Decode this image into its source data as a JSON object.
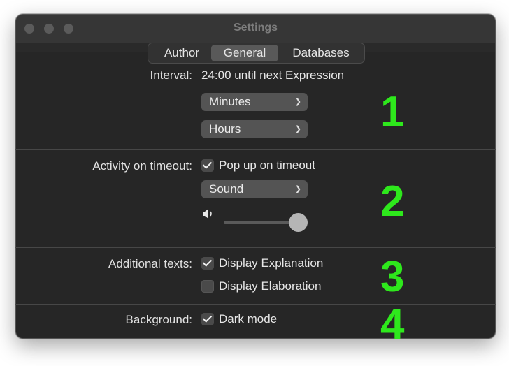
{
  "window": {
    "title": "Settings"
  },
  "tabs": [
    {
      "label": "Author",
      "selected": false
    },
    {
      "label": "General",
      "selected": true
    },
    {
      "label": "Databases",
      "selected": false
    }
  ],
  "interval": {
    "label": "Interval:",
    "value_text": "24:00 until next Expression",
    "popup_1": "Minutes",
    "popup_2": "Hours"
  },
  "activity": {
    "label": "Activity on timeout:",
    "checkbox_label": "Pop up on timeout",
    "checked": true,
    "sound_popup": "Sound",
    "volume": 1.0
  },
  "additional": {
    "label": "Additional texts:",
    "explanation_label": "Display Explanation",
    "explanation_checked": true,
    "elaboration_label": "Display Elaboration",
    "elaboration_checked": false
  },
  "background": {
    "label": "Background:",
    "dark_mode_label": "Dark mode",
    "dark_mode_checked": true
  },
  "annotations": [
    "1",
    "2",
    "3",
    "4"
  ],
  "colors": {
    "annotation": "#2ee81c",
    "window_bg": "#262626"
  },
  "icons": {
    "dropdown": "chevron-down-icon",
    "volume": "speaker-icon",
    "check": "checkmark-icon"
  }
}
